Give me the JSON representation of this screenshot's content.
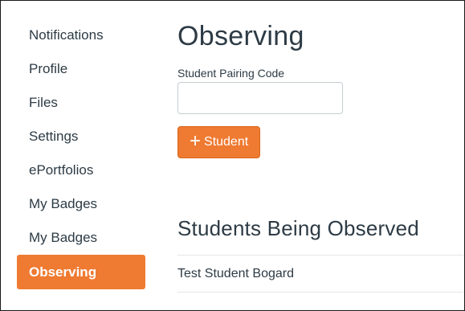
{
  "sidebar": {
    "items": [
      {
        "label": "Notifications"
      },
      {
        "label": "Profile"
      },
      {
        "label": "Files"
      },
      {
        "label": "Settings"
      },
      {
        "label": "ePortfolios"
      },
      {
        "label": "My Badges"
      },
      {
        "label": "My Badges"
      },
      {
        "label": "Observing",
        "active": true
      }
    ]
  },
  "main": {
    "title": "Observing",
    "pairing_code": {
      "label": "Student Pairing Code",
      "value": "",
      "placeholder": ""
    },
    "add_button": {
      "icon": "plus-icon",
      "label": "Student"
    },
    "observed_section": {
      "title": "Students Being Observed",
      "students": [
        "Test Student Bogard"
      ]
    }
  },
  "colors": {
    "accent": "#ef7a31",
    "text": "#2d3b45",
    "divider": "#e2e6e8",
    "input_border": "#c7cdd1"
  }
}
